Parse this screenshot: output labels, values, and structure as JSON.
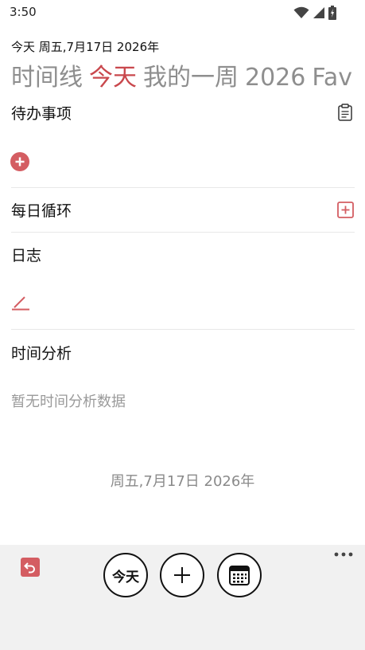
{
  "status_bar": {
    "time": "3:50"
  },
  "header": {
    "date_line": "今天  周五,7月17日 2026年",
    "tabs": [
      {
        "label": "时间线",
        "active": false
      },
      {
        "label": "今天",
        "active": true
      },
      {
        "label": "我的一周",
        "active": false
      },
      {
        "label": "2026",
        "active": false
      },
      {
        "label": "Fav",
        "active": false
      }
    ]
  },
  "sections": {
    "todo": {
      "title": "待办事项"
    },
    "daily": {
      "title": "每日循环"
    },
    "journal": {
      "title": "日志"
    },
    "analysis": {
      "title": "时间分析",
      "empty": "暂无时间分析数据"
    }
  },
  "footer": {
    "date": "周五,7月17日 2026年"
  },
  "bottom_nav": {
    "today_label": "今天"
  },
  "colors": {
    "accent": "#c9484d",
    "inactive_tab": "#8e8e8e",
    "bottom_bar": "#f1f1f1"
  }
}
